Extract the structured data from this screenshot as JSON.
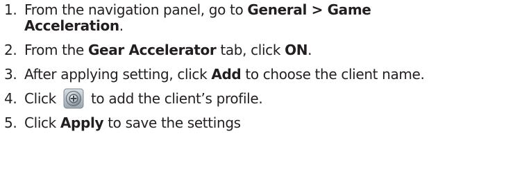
{
  "steps": [
    {
      "number": "1.",
      "before": "From the navigation panel, go to ",
      "bold": "General > Game",
      "bold_line2": "Acceleration",
      "after": "."
    },
    {
      "number": "2.",
      "before": "From the ",
      "bold": "Gear Accelerator",
      "middle": " tab, click ",
      "bold2": "ON",
      "after": "."
    },
    {
      "number": "3.",
      "before": "After applying setting, click ",
      "bold": "Add",
      "after": " to choose the client name."
    },
    {
      "number": "4.",
      "before": "Click",
      "icon": "add-profile-icon",
      "after": "to add the client’s profile."
    },
    {
      "number": "5.",
      "before": "Click ",
      "bold": "Apply",
      "after": " to save the settings"
    }
  ]
}
